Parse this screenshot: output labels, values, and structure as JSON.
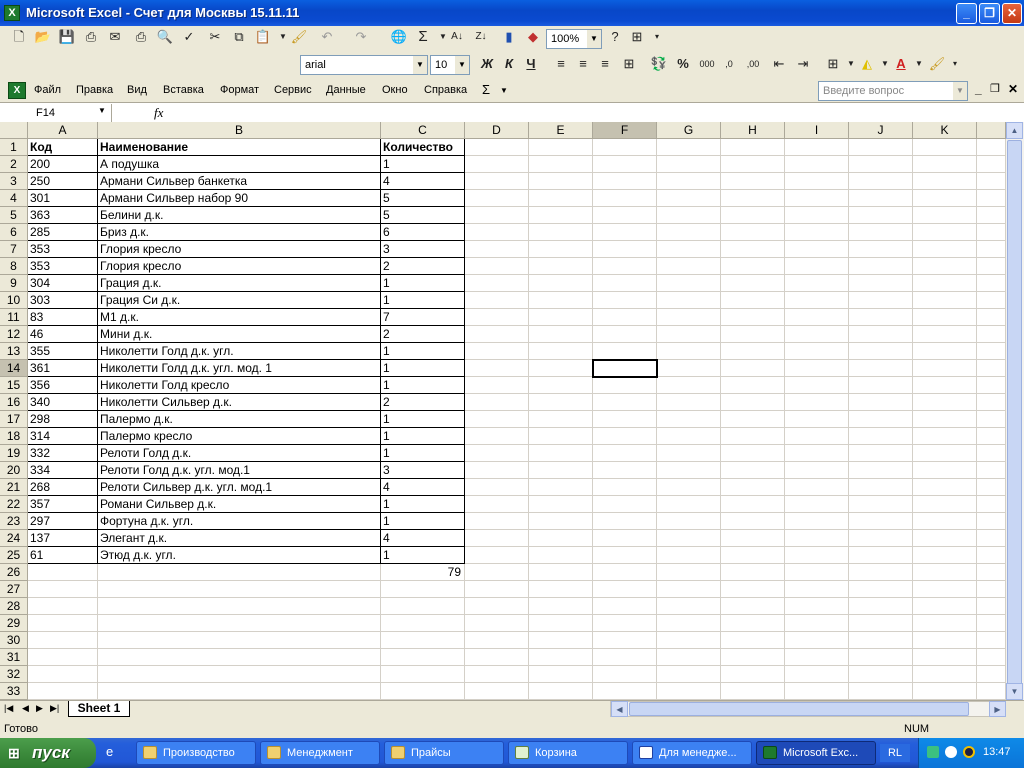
{
  "window": {
    "title": "Microsoft Excel - Счет для Москвы 15.11.11",
    "app_icon": "excel-icon"
  },
  "toolbar": {
    "font_name": "arial",
    "font_size": "10",
    "zoom": "100%"
  },
  "menu": {
    "items": [
      "Файл",
      "Правка",
      "Вид",
      "Вставка",
      "Формат",
      "Сервис",
      "Данные",
      "Окно",
      "Справка"
    ],
    "sigma": "Σ",
    "help_placeholder": "Введите вопрос"
  },
  "formula_bar": {
    "name_box": "F14",
    "fx": "fx",
    "formula": ""
  },
  "columns": [
    "A",
    "B",
    "C",
    "D",
    "E",
    "F",
    "G",
    "H",
    "I",
    "J",
    "K"
  ],
  "selected_column": "F",
  "selected_row": 14,
  "active_cell": "F14",
  "header_row": [
    "Код",
    "Наименование",
    "Количество"
  ],
  "rows": [
    {
      "code": "200",
      "name": "А подушка",
      "qty": "1"
    },
    {
      "code": "250",
      "name": "Армани Сильвер банкетка",
      "qty": "4"
    },
    {
      "code": "301",
      "name": "Армани Сильвер набор 90",
      "qty": "5"
    },
    {
      "code": "363",
      "name": "Белини д.к.",
      "qty": "5"
    },
    {
      "code": "285",
      "name": "Бриз д.к.",
      "qty": "6"
    },
    {
      "code": "353",
      "name": "Глория кресло",
      "qty": "3"
    },
    {
      "code": "353",
      "name": "Глория кресло",
      "qty": "2"
    },
    {
      "code": "304",
      "name": "Грация д.к.",
      "qty": "1"
    },
    {
      "code": "303",
      "name": "Грация Си д.к.",
      "qty": "1"
    },
    {
      "code": "83",
      "name": "М1 д.к.",
      "qty": "7"
    },
    {
      "code": "46",
      "name": "Мини д.к.",
      "qty": "2"
    },
    {
      "code": "355",
      "name": "Николетти Голд д.к. угл.",
      "qty": "1"
    },
    {
      "code": "361",
      "name": "Николетти Голд д.к. угл. мод. 1",
      "qty": "1"
    },
    {
      "code": "356",
      "name": "Николетти Голд кресло",
      "qty": "1"
    },
    {
      "code": "340",
      "name": "Николетти Сильвер д.к.",
      "qty": "2"
    },
    {
      "code": "298",
      "name": "Палермо д.к.",
      "qty": "1"
    },
    {
      "code": "314",
      "name": "Палермо кресло",
      "qty": "1"
    },
    {
      "code": "332",
      "name": "Релоти Голд д.к.",
      "qty": "1"
    },
    {
      "code": "334",
      "name": "Релоти Голд д.к. угл. мод.1",
      "qty": "3"
    },
    {
      "code": "268",
      "name": "Релоти Сильвер д.к. угл. мод.1",
      "qty": "4"
    },
    {
      "code": "357",
      "name": "Романи Сильвер д.к.",
      "qty": "1"
    },
    {
      "code": "297",
      "name": "Фортуна д.к. угл.",
      "qty": "1"
    },
    {
      "code": "137",
      "name": "Элегант д.к.",
      "qty": "4"
    },
    {
      "code": "61",
      "name": "Этюд д.к. угл.",
      "qty": "1"
    }
  ],
  "total": "79",
  "row_count": 33,
  "sheet_tab": "Sheet 1",
  "status": {
    "ready": "Готово",
    "num": "NUM"
  },
  "taskbar": {
    "start": "пуск",
    "items": [
      "Производство",
      "Менеджмент",
      "Прайсы",
      "Корзина",
      "Для менедже...",
      "Microsoft Exc..."
    ],
    "lang": "RL",
    "clock": "13:47"
  }
}
